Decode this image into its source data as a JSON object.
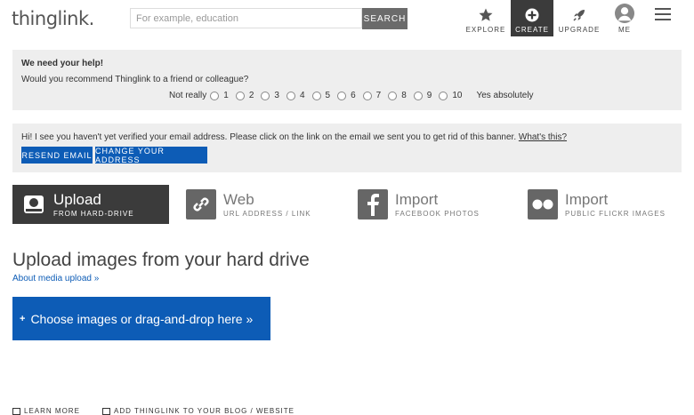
{
  "header": {
    "logo": "thinglink.",
    "search_placeholder": "For example, education",
    "search_button": "SEARCH",
    "nav": [
      {
        "label": "EXPLORE",
        "icon": "star-icon"
      },
      {
        "label": "CREATE",
        "icon": "plus-circle-icon",
        "active": true
      },
      {
        "label": "UPGRADE",
        "icon": "rocket-icon"
      },
      {
        "label": "ME",
        "icon": "user-avatar-icon"
      }
    ]
  },
  "survey": {
    "title": "We need your help!",
    "question": "Would you recommend Thinglink to a friend or colleague?",
    "low_label": "Not really",
    "high_label": "Yes absolutely",
    "options": [
      "1",
      "2",
      "3",
      "4",
      "5",
      "6",
      "7",
      "8",
      "9",
      "10"
    ]
  },
  "verify": {
    "message": "Hi! I see you haven't yet verified your email address. Please click on the link on the email we sent you to get rid of this banner.",
    "link": "What's this?",
    "resend_button": "RESEND EMAIL",
    "change_button": "CHANGE YOUR ADDRESS"
  },
  "upload_options": [
    {
      "title": "Upload",
      "subtitle": "FROM HARD-DRIVE",
      "icon": "hard-drive-icon",
      "active": true
    },
    {
      "title": "Web",
      "subtitle": "URL ADDRESS / LINK",
      "icon": "link-icon"
    },
    {
      "title": "Import",
      "subtitle": "FACEBOOK PHOTOS",
      "icon": "facebook-icon"
    },
    {
      "title": "Import",
      "subtitle": "PUBLIC FLICKR IMAGES",
      "icon": "flickr-icon"
    }
  ],
  "main": {
    "title": "Upload images from your hard drive",
    "about_link": "About media upload »",
    "choose_button": "Choose images or drag-and-drop here »"
  },
  "footer": {
    "learn_more": "LEARN MORE",
    "add_thinglink": "ADD THINGLINK TO YOUR BLOG / WEBSITE"
  },
  "colors": {
    "accent": "#0d5cb6",
    "dark": "#3b3b3b",
    "panel": "#eeeeee"
  }
}
